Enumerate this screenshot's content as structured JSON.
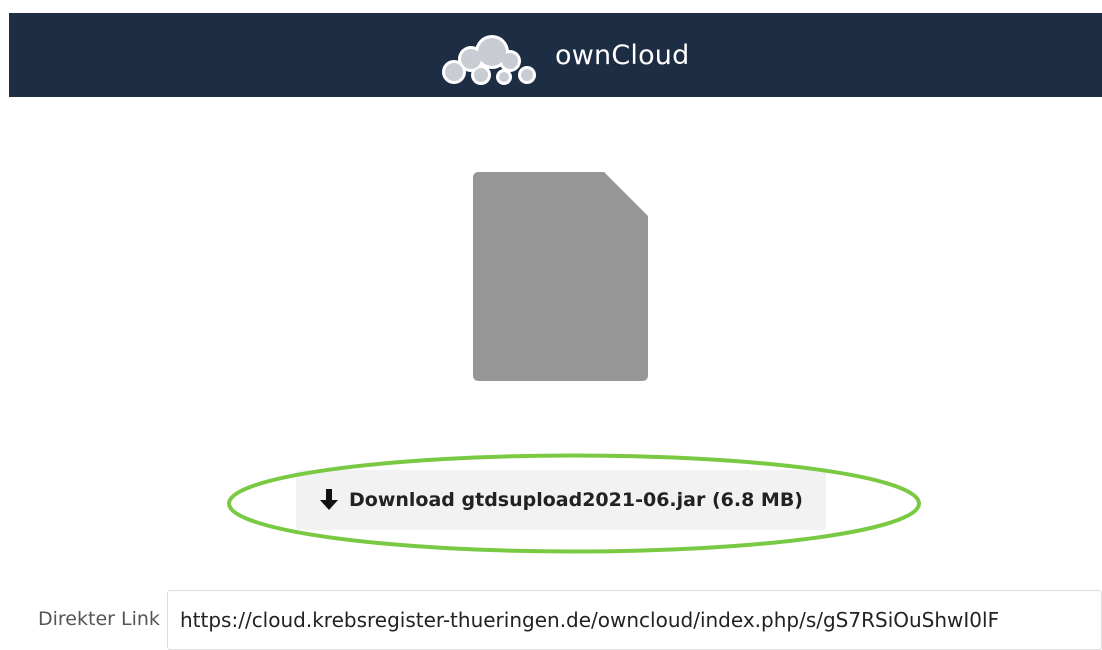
{
  "header": {
    "logo_icon": "cloud-logo-icon",
    "brand_name": "ownCloud",
    "background_color": "#1d2d44"
  },
  "file": {
    "icon": "file-icon",
    "icon_color": "#969696"
  },
  "download": {
    "icon": "arrow-down-icon",
    "label": "Download gtdsupload2021-06.jar (6.8 MB)",
    "highlight_color": "#7ac943"
  },
  "direct_link": {
    "label": "Direkter Link",
    "value": "https://cloud.krebsregister-thueringen.de/owncloud/index.php/s/gS7RSiOuShwI0lF"
  }
}
